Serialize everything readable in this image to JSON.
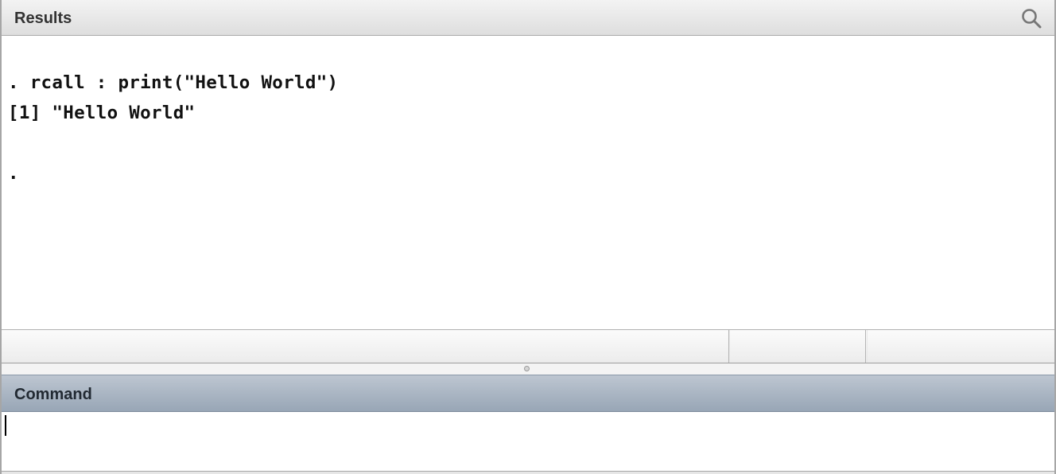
{
  "results": {
    "title": "Results",
    "search_icon": "search-icon",
    "lines": [
      ". rcall : print(\"Hello World\")",
      "[1] \"Hello World\"",
      "",
      "."
    ]
  },
  "command": {
    "title": "Command",
    "value": "",
    "placeholder": ""
  },
  "colors": {
    "command_header": "#a9b5c3",
    "results_header": "#e6e6e6",
    "text": "#111111"
  }
}
